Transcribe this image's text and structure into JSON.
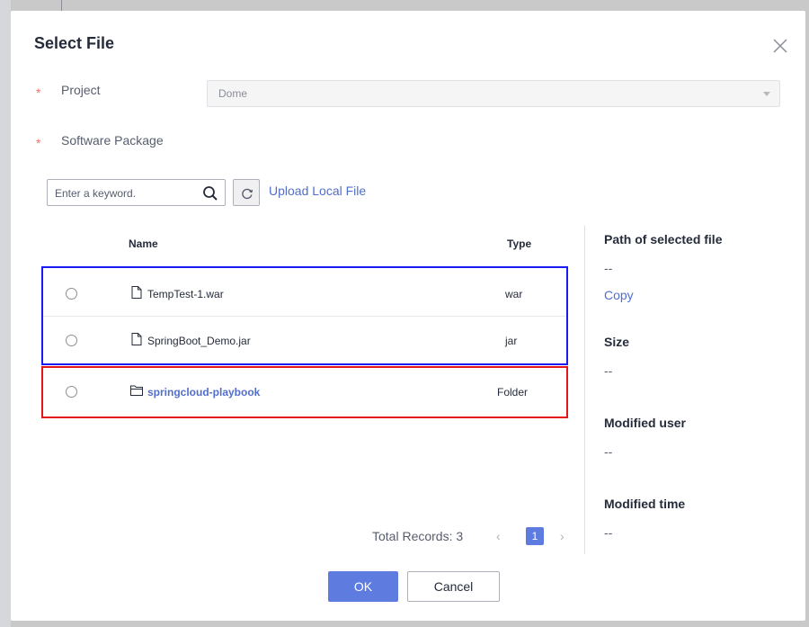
{
  "dialog": {
    "title": "Select File",
    "close_icon": "close-icon"
  },
  "form": {
    "required_mark": "*",
    "project_label": "Project",
    "project_value": "Dome",
    "package_label": "Software Package"
  },
  "toolbar": {
    "search_placeholder": "Enter a keyword.",
    "search_icon": "search-icon",
    "refresh_icon": "refresh-icon",
    "upload_label": "Upload Local File"
  },
  "table": {
    "headers": {
      "name": "Name",
      "type": "Type"
    },
    "rows": [
      {
        "name": "TempTest-1.war",
        "type": "war",
        "icon": "file-icon"
      },
      {
        "name": "SpringBoot_Demo.jar",
        "type": "jar",
        "icon": "file-icon"
      },
      {
        "name": "springcloud-playbook",
        "type": "Folder",
        "icon": "folder-icon"
      }
    ]
  },
  "details": {
    "path_label": "Path of selected file",
    "path_value": "--",
    "copy_label": "Copy",
    "size_label": "Size",
    "size_value": "--",
    "user_label": "Modified user",
    "user_value": "--",
    "time_label": "Modified time",
    "time_value": "--"
  },
  "pager": {
    "total": "Total Records: 3",
    "prev": "‹",
    "current_page": "1",
    "next": "›"
  },
  "footer": {
    "ok_label": "OK",
    "cancel_label": "Cancel"
  },
  "colors": {
    "accent": "#5e7ce0",
    "link": "#526ecc",
    "required": "#f66f6a",
    "highlight_blue": "#1a1af5",
    "highlight_red": "#e5131b"
  }
}
